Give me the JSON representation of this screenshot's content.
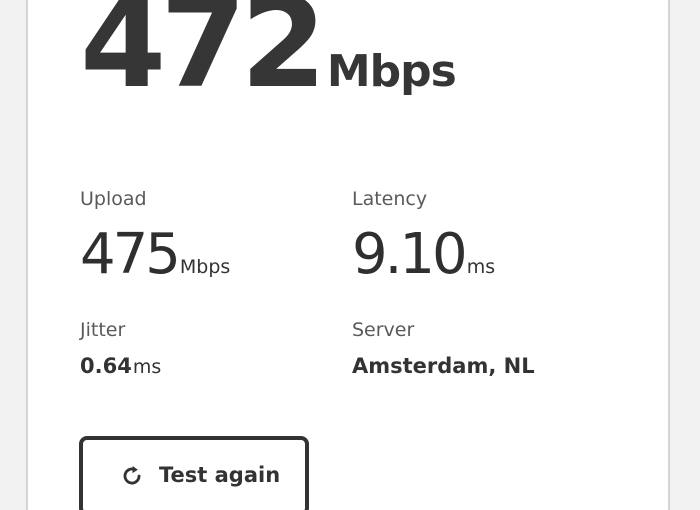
{
  "download": {
    "value": "472",
    "unit": "Mbps"
  },
  "upload": {
    "label": "Upload",
    "value": "475",
    "unit": "Mbps"
  },
  "latency": {
    "label": "Latency",
    "value": "9.10",
    "unit": "ms"
  },
  "jitter": {
    "label": "Jitter",
    "value": "0.64",
    "unit": "ms"
  },
  "server": {
    "label": "Server",
    "value": "Amsterdam, NL"
  },
  "button": {
    "label": "Test again",
    "icon": "refresh-icon"
  },
  "colors": {
    "text": "#333333",
    "label": "#5a5a5a",
    "card_border": "#d4d4d4",
    "background": "#ffffff"
  }
}
